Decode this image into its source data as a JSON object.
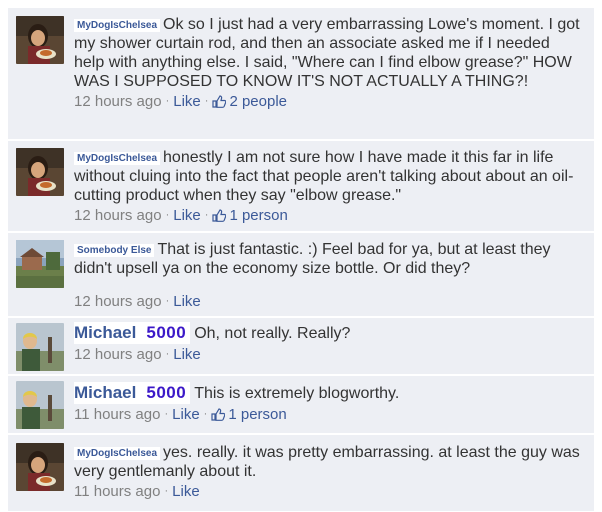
{
  "colors": {
    "row_bg": "#edeff4",
    "link": "#3b5998",
    "timestamp": "#808080",
    "score": "#3b18c8"
  },
  "comments": [
    {
      "author": "MyDogIsChelsea",
      "text": "Ok so I just had a very embarrassing Lowe's moment. I got my shower curtain rod, and then an associate asked me if I needed help with anything else. I said, \"Where can I find elbow grease?\" HOW WAS I SUPPOSED TO KNOW IT'S NOT ACTUALLY A THING?!",
      "time": "12 hours ago",
      "like_label": "Like",
      "likes": "2 people"
    },
    {
      "author": "MyDogIsChelsea",
      "text": "honestly I am not sure how I have made it this far in life without cluing into the fact that people aren't talking about about an oil-cutting product when they say \"elbow grease.\"",
      "time": "12 hours ago",
      "like_label": "Like",
      "likes": "1 person"
    },
    {
      "author": "Somebody Else",
      "text": "That is just fantastic. :) Feel bad for ya, but at least they didn't upsell ya on the economy size bottle. Or did they?",
      "time": "12 hours ago",
      "like_label": "Like"
    },
    {
      "author": "Michael",
      "score": "5000",
      "text": "Oh, not really. Really?",
      "time": "12 hours ago",
      "like_label": "Like"
    },
    {
      "author": "Michael",
      "score": "5000",
      "text": "This is extremely blogworthy.",
      "time": "11 hours ago",
      "like_label": "Like",
      "likes": "1 person"
    },
    {
      "author": "MyDogIsChelsea",
      "text": "yes. really. it was pretty embarrassing. at least the guy was very gentlemanly about it.",
      "time": "11 hours ago",
      "like_label": "Like"
    }
  ]
}
